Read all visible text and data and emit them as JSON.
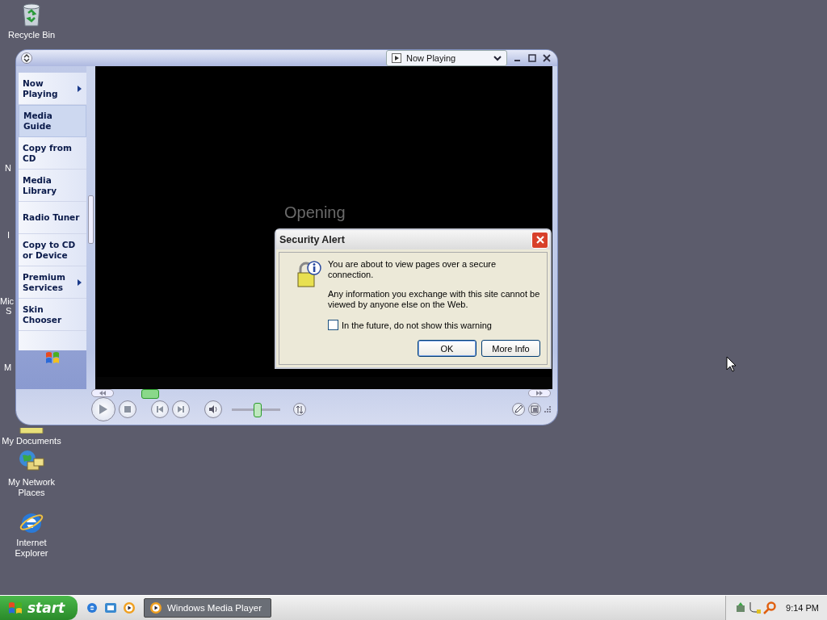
{
  "desktop_icons": [
    {
      "label": "Recycle Bin",
      "kind": "recycle"
    },
    {
      "label": "My Documents",
      "kind": "folder"
    },
    {
      "label": "My Network Places",
      "kind": "network"
    },
    {
      "label": "Internet Explorer",
      "kind": "ie"
    }
  ],
  "desktop_fragments": [
    "N",
    "I",
    "Mic",
    "S",
    "M"
  ],
  "player": {
    "view_selector": "Now Playing",
    "nav": [
      {
        "label": "Now Playing",
        "selected": false,
        "submenu": true
      },
      {
        "label": "Media Guide",
        "selected": true,
        "submenu": false
      },
      {
        "label": "Copy from CD",
        "selected": false,
        "submenu": false
      },
      {
        "label": "Media Library",
        "selected": false,
        "submenu": false
      },
      {
        "label": "Radio Tuner",
        "selected": false,
        "submenu": false
      },
      {
        "label": "Copy to CD or Device",
        "selected": false,
        "submenu": false
      },
      {
        "label": "Premium Services",
        "selected": false,
        "submenu": true
      },
      {
        "label": "Skin Chooser",
        "selected": false,
        "submenu": false
      }
    ],
    "status": "Opening"
  },
  "dialog": {
    "title": "Security Alert",
    "message": "You are about to view pages over a secure connection.",
    "detail": "Any information you exchange with this site cannot be viewed by anyone else on the Web.",
    "checkbox": {
      "label": "In the future, do not show this warning",
      "checked": false
    },
    "buttons": [
      {
        "label": "OK",
        "default": true
      },
      {
        "label": "More Info",
        "default": false
      }
    ]
  },
  "taskbar": {
    "start": "start",
    "tasks": [
      {
        "label": "Windows Media Player",
        "selected": true
      }
    ],
    "clock": "9:14 PM"
  }
}
